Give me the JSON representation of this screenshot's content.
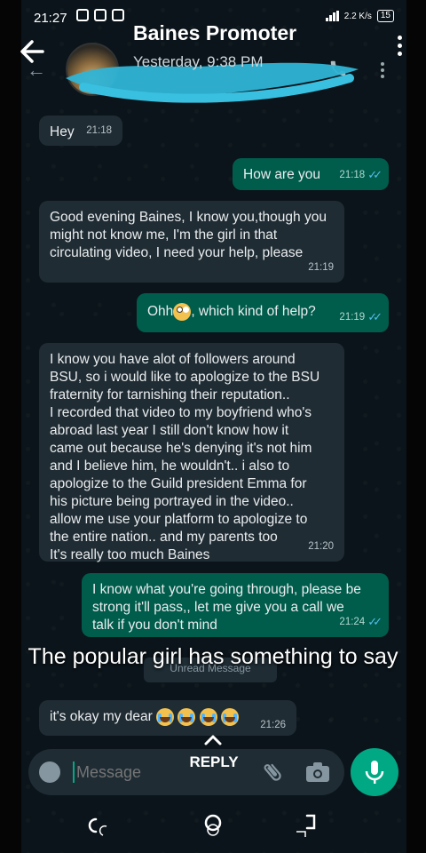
{
  "status_bar": {
    "time": "21:27",
    "network_speed": "2.2 K/s",
    "battery": "15"
  },
  "header": {
    "contact_name": "Baines Promoter",
    "last_seen": "Yesterday, 9:38 PM"
  },
  "messages": [
    {
      "direction": "in",
      "text": "Hey",
      "time": "21:18"
    },
    {
      "direction": "out",
      "text": "How are you",
      "time": "21:18"
    },
    {
      "direction": "in",
      "text": "Good evening Baines, I know you,though you\nmight not know me, I'm the girl in that\ncirculating video, I need your help, please",
      "time": "21:19"
    },
    {
      "direction": "out",
      "text_before_emoji": "Ohh",
      "text_after_emoji": ", which kind of help?",
      "time": "21:19"
    },
    {
      "direction": "in",
      "text": "I know you have alot of followers around\nBSU, so i would like to apologize to  the BSU\nfraternity for tarnishing their reputation..\nI recorded that video to my boyfriend who's\nabroad last year I still don't know how it\ncame out because he's denying it's not him\nand I believe him, he wouldn't.. i also to\napologize to the Guild president Emma for\nhis picture being portrayed in the video..\nallow me use your platform to apologize to\nthe entire nation.. and my parents too\nIt's really too much Baines",
      "time": "21:20"
    },
    {
      "direction": "out",
      "text": "I know what you're going through, please be\nstrong it'll pass,, let me give you a call we\ntalk if you don't mind",
      "time": "21:24"
    },
    {
      "direction": "in",
      "text": "it's okay my dear",
      "time": "21:26"
    }
  ],
  "unread_label": "Unread Message",
  "overlay_caption": "The popular girl has something to say",
  "composer": {
    "placeholder": "Message"
  },
  "reply_label": "REPLY",
  "colors": {
    "incoming": "#202c33",
    "outgoing": "#005c4b",
    "accent": "#00a884",
    "ticks": "#53bdeb",
    "scribble": "#2fb4d6"
  },
  "icons": [
    "back-arrow-icon",
    "more-vert-icon",
    "call-icon",
    "emoji-icon",
    "attach-icon",
    "camera-icon",
    "mic-icon",
    "chevron-up-icon",
    "recent-apps-icon",
    "home-icon",
    "nav-back-icon"
  ]
}
